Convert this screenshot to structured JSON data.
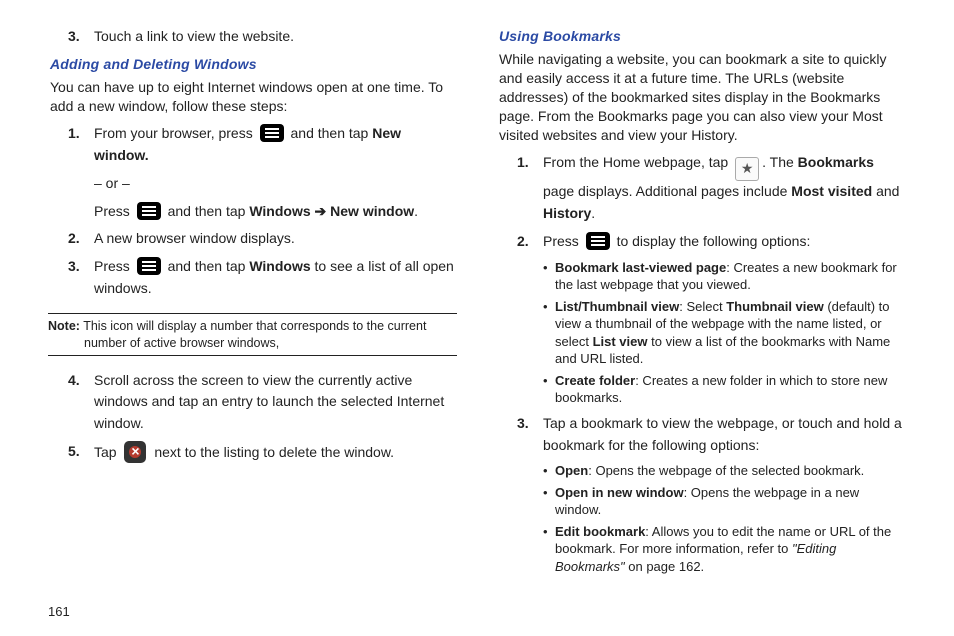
{
  "pageNumber": "161",
  "left": {
    "item3": "Touch a link to view the website.",
    "heading": "Adding and Deleting Windows",
    "intro": "You can have up to eight Internet windows open at one time. To add a new window, follow these steps:",
    "steps1": {
      "a_before": "From your browser, press ",
      "a_after": " and then tap ",
      "a_bold": "New window.",
      "or": "– or –",
      "b_before": "Press ",
      "b_mid": " and then tap ",
      "b_bold1": "Windows",
      "b_arrow": " ➔ ",
      "b_bold2": "New window",
      "b_period": "."
    },
    "step2": "A new browser window displays.",
    "step3": {
      "before": "Press ",
      "mid": " and then tap ",
      "bold": "Windows",
      "after": " to see a list of all open windows."
    },
    "note": {
      "label": "Note:",
      "text": "This icon will display a number that corresponds to the current number of active browser windows,"
    },
    "step4": "Scroll across the screen to view the currently active windows and tap an entry to launch the selected Internet window.",
    "step5": {
      "before": "Tap ",
      "after": " next to the listing to delete the window."
    }
  },
  "right": {
    "heading": "Using Bookmarks",
    "intro": "While navigating a website, you can bookmark a site to quickly and easily access it at a future time. The URLs (website addresses) of the bookmarked sites display in the Bookmarks page. From the Bookmarks page you can also view your Most visited websites and view your History.",
    "step1": {
      "before": "From the Home webpage, tap ",
      "mid": ". The ",
      "bold1": "Bookmarks",
      "after1": " page displays. Additional pages include ",
      "bold2": "Most visited",
      "and": " and ",
      "bold3": "History",
      "period": "."
    },
    "step2": {
      "before": "Press ",
      "after": " to display the following options:"
    },
    "opts": {
      "a_bold": "Bookmark last-viewed page",
      "a_text": ": Creates a new bookmark for the last webpage that you viewed.",
      "b_bold": "List/Thumbnail view",
      "b_text1": ": Select ",
      "b_bold2": "Thumbnail view",
      "b_text2": " (default) to view a thumbnail of the webpage with the name listed, or select ",
      "b_bold3": "List view",
      "b_text3": " to view a list of the bookmarks with Name and URL listed.",
      "c_bold": "Create folder",
      "c_text": ": Creates a new folder in which to store new bookmarks."
    },
    "step3": "Tap a bookmark to view the webpage, or touch and hold a bookmark for the following options:",
    "opts2": {
      "a_bold": "Open",
      "a_text": ": Opens the webpage of the selected bookmark.",
      "b_bold": "Open in new window",
      "b_text": ": Opens the webpage in a new window.",
      "c_bold": "Edit bookmark",
      "c_text1": ": Allows you to edit the name or URL of the bookmark. For more information, refer to ",
      "c_ref": "\"Editing Bookmarks\"",
      "c_text2": " on page 162."
    }
  }
}
